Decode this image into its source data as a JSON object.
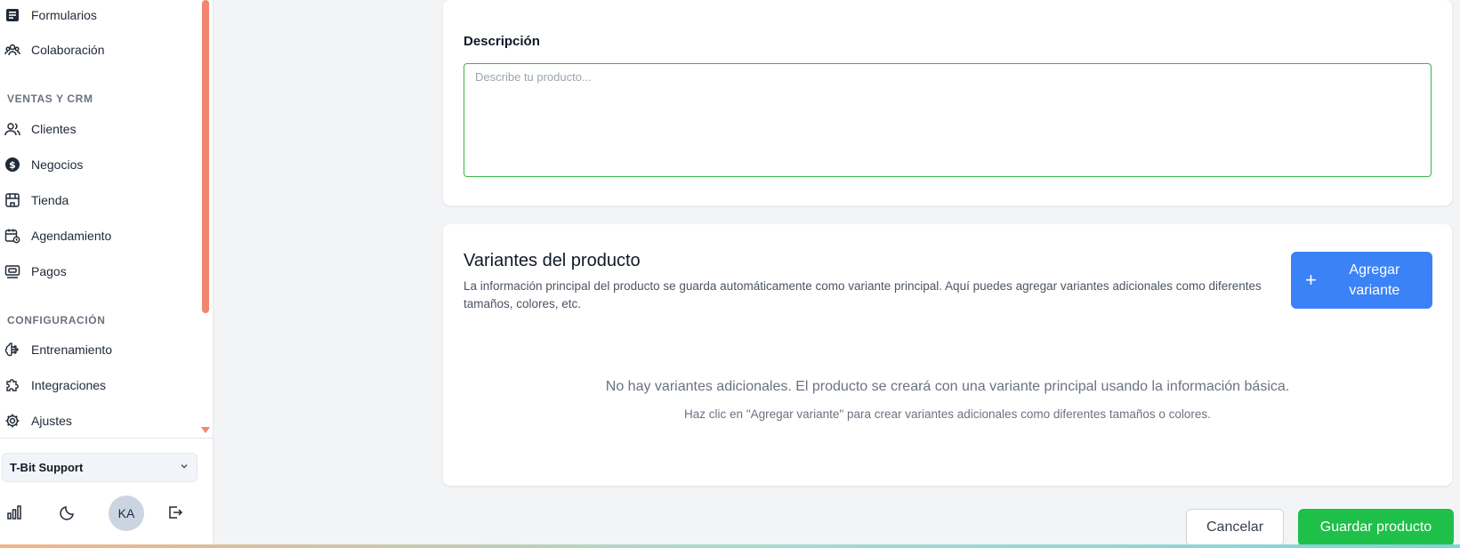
{
  "sidebar": {
    "items_top": [
      {
        "label": "Formularios",
        "icon": "form-icon"
      },
      {
        "label": "Colaboración",
        "icon": "team-icon"
      }
    ],
    "sections": [
      {
        "title": "VENTAS Y CRM",
        "items": [
          {
            "label": "Clientes",
            "icon": "users-icon"
          },
          {
            "label": "Negocios",
            "icon": "dollar-icon"
          },
          {
            "label": "Tienda",
            "icon": "store-icon"
          },
          {
            "label": "Agendamiento",
            "icon": "calendar-icon"
          },
          {
            "label": "Pagos",
            "icon": "payment-icon"
          }
        ]
      },
      {
        "title": "CONFIGURACIÓN",
        "items": [
          {
            "label": "Entrenamiento",
            "icon": "brain-icon"
          },
          {
            "label": "Integraciones",
            "icon": "puzzle-icon"
          },
          {
            "label": "Ajustes",
            "icon": "gear-icon"
          }
        ]
      }
    ],
    "workspace": "T-Bit Support",
    "avatar": "KA"
  },
  "description": {
    "label": "Descripción",
    "placeholder": "Describe tu producto..."
  },
  "variants": {
    "title": "Variantes del producto",
    "info": "La información principal del producto se guarda automáticamente como variante principal. Aquí puedes agregar variantes adicionales como diferentes tamaños, colores, etc.",
    "add_button": "Agregar variante",
    "empty_main": "No hay variantes adicionales. El producto se creará con una variante principal usando la información básica.",
    "empty_sub": "Haz clic en \"Agregar variante\" para crear variantes adicionales como diferentes tamaños o colores."
  },
  "actions": {
    "cancel": "Cancelar",
    "save": "Guardar producto"
  },
  "colors": {
    "accent_blue": "#3b82f6",
    "save_green": "#1ec04a",
    "scrollbar": "#f08570",
    "textarea_border": "#3ab54a"
  }
}
